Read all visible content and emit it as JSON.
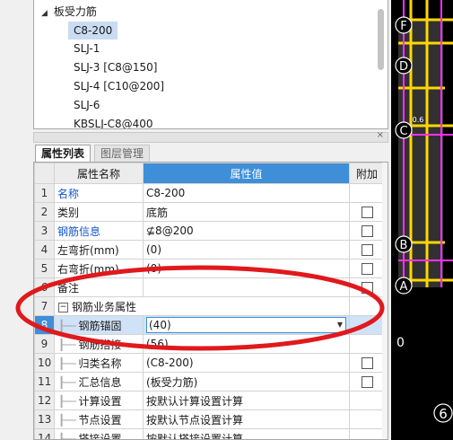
{
  "tree": {
    "group_label": "板受力筋",
    "items": [
      "C8-200",
      "SLJ-1",
      "SLJ-3 [C8@150]",
      "SLJ-4 [C10@200]",
      "SLJ-6",
      "KBSLJ-C8@400"
    ]
  },
  "panel": {
    "close": "×"
  },
  "tabs": [
    "属性列表",
    "图层管理"
  ],
  "grid": {
    "headers": [
      "属性名称",
      "属性值",
      "附加"
    ],
    "rows": [
      {
        "n": "1",
        "name": "名称",
        "value": "C8-200"
      },
      {
        "n": "2",
        "name": "类别",
        "value": "底筋"
      },
      {
        "n": "3",
        "name": "钢筋信息",
        "value": "⊈8@200"
      },
      {
        "n": "4",
        "name": "左弯折(mm)",
        "value": "(0)"
      },
      {
        "n": "5",
        "name": "右弯折(mm)",
        "value": "(0)"
      },
      {
        "n": "6",
        "name": "备注",
        "value": ""
      },
      {
        "n": "7",
        "name": "钢筋业务属性",
        "value": "",
        "toggle": "−"
      },
      {
        "n": "8",
        "name": "钢筋锚固",
        "value": "(40)"
      },
      {
        "n": "9",
        "name": "钢筋搭接",
        "value": "(56)"
      },
      {
        "n": "10",
        "name": "归类名称",
        "value": "(C8-200)"
      },
      {
        "n": "11",
        "name": "汇总信息",
        "value": "(板受力筋)"
      },
      {
        "n": "12",
        "name": "计算设置",
        "value": "按默认计算设置计算"
      },
      {
        "n": "13",
        "name": "节点设置",
        "value": "按默认节点设置计算"
      },
      {
        "n": "14",
        "name": "搭接设置",
        "value": "按默认搭接设置计算"
      }
    ]
  },
  "cad": {
    "labels": [
      "F",
      "D",
      "C",
      "B",
      "A",
      "6"
    ],
    "dim": "0.6",
    "readout": "0"
  },
  "colors": {
    "accent": "#3e8fd8",
    "highlight": "#e0191c",
    "cad_bg": "#000000"
  }
}
